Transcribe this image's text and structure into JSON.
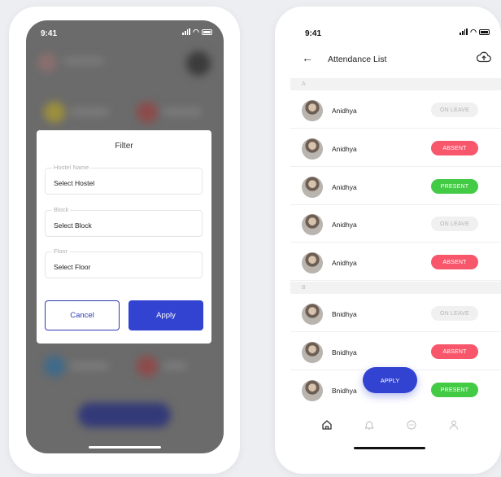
{
  "left_screen": {
    "status_time": "9:41",
    "filter": {
      "title": "Filter",
      "fields": [
        {
          "label": "Hostel Name",
          "value": "Select Hostel"
        },
        {
          "label": "Block",
          "value": "Select Block"
        },
        {
          "label": "Floor",
          "value": "Select Floor"
        }
      ],
      "cancel_label": "Cancel",
      "apply_label": "Apply"
    }
  },
  "right_screen": {
    "status_time": "9:41",
    "title": "Attendance List",
    "sections": [
      {
        "letter": "A",
        "rows": [
          {
            "name": "Anidhya",
            "status": "ON LEAVE"
          },
          {
            "name": "Anidhya",
            "status": "ABSENT"
          },
          {
            "name": "Anidhya",
            "status": "PRESENT"
          },
          {
            "name": "Anidhya",
            "status": "ON LEAVE"
          },
          {
            "name": "Anidhya",
            "status": "ABSENT"
          }
        ]
      },
      {
        "letter": "B",
        "rows": [
          {
            "name": "Bnidhya",
            "status": "ON LEAVE"
          },
          {
            "name": "Bnidhya",
            "status": "ABSENT"
          },
          {
            "name": "Bnidhya",
            "status": "PRESENT"
          }
        ]
      }
    ],
    "fab_label": "APPLY",
    "tabs": [
      "home-icon",
      "bell-icon",
      "chat-icon",
      "user-icon"
    ]
  },
  "colors": {
    "primary": "#3143d0",
    "absent": "#f8566b",
    "present": "#44cb46",
    "on_leave": "#f0f0f0"
  }
}
